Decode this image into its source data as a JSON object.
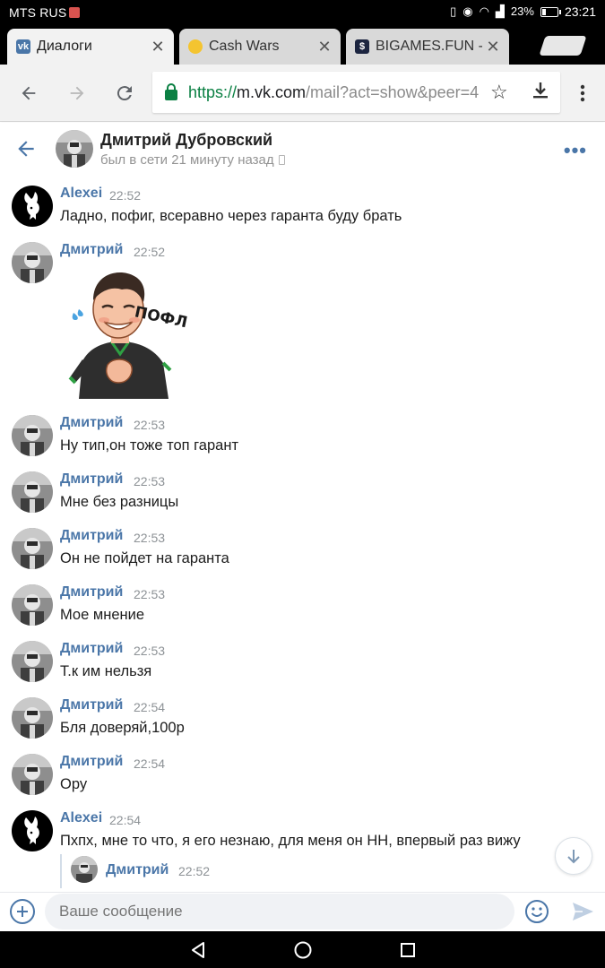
{
  "statusbar": {
    "carrier": "MTS RUS",
    "battery": "23%",
    "time": "23:21"
  },
  "tabs": [
    {
      "title": "Диалоги",
      "favicon": "vk-logo-icon",
      "active": true
    },
    {
      "title": "Cash Wars",
      "favicon": "coin-icon",
      "active": false
    },
    {
      "title": "BIGAMES.FUN - S",
      "favicon": "dollar-icon",
      "active": false
    }
  ],
  "omnibox": {
    "scheme": "https://",
    "host": "m.vk.com",
    "path": "/mail?act=show&peer=4"
  },
  "chat_header": {
    "name": "Дмитрий Дубровский",
    "status": "был в сети 21 минуту назад"
  },
  "messages": [
    {
      "author": "Alexei",
      "time": "22:52",
      "text": "Ладно, пофиг, всеравно через гаранта буду брать",
      "avatar": "playboy-bunny-avatar"
    },
    {
      "author": "Дмитрий",
      "time": "22:52",
      "text": "",
      "sticker": "ПОФЛ!",
      "avatar": "dmitry-avatar"
    },
    {
      "author": "Дмитрий",
      "time": "22:53",
      "text": "Ну тип,он тоже топ гарант",
      "avatar": "dmitry-avatar"
    },
    {
      "author": "Дмитрий",
      "time": "22:53",
      "text": "Мне без разницы",
      "avatar": "dmitry-avatar"
    },
    {
      "author": "Дмитрий",
      "time": "22:53",
      "text": "Он не пойдет на гаранта",
      "avatar": "dmitry-avatar"
    },
    {
      "author": "Дмитрий",
      "time": "22:53",
      "text": "Мое мнение",
      "avatar": "dmitry-avatar"
    },
    {
      "author": "Дмитрий",
      "time": "22:53",
      "text": "Т.к им нельзя",
      "avatar": "dmitry-avatar"
    },
    {
      "author": "Дмитрий",
      "time": "22:54",
      "text": "Бля доверяй,100р",
      "avatar": "dmitry-avatar"
    },
    {
      "author": "Дмитрий",
      "time": "22:54",
      "text": "Ору",
      "avatar": "dmitry-avatar"
    },
    {
      "author": "Alexei",
      "time": "22:54",
      "text": "Пхпх, мне то что, я его незнаю, для меня он НН, впервый раз вижу",
      "avatar": "playboy-bunny-avatar"
    }
  ],
  "forwarded": {
    "author": "Дмитрий",
    "time": "22:52"
  },
  "composer": {
    "placeholder": "Ваше сообщение"
  },
  "colors": {
    "vk_blue": "#4a76a8",
    "chrome_secure": "#0b8043",
    "time_gray": "#8d9296"
  }
}
